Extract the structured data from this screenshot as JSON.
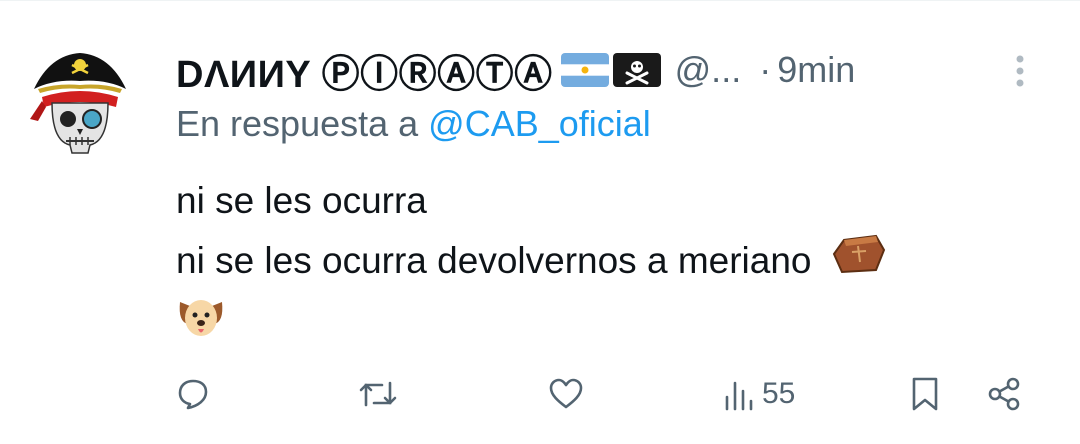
{
  "tweet": {
    "display_name": "DΛИИY ⓅⒾⓇⒶⓉⒶ",
    "handle": "@...",
    "separator": "·",
    "time": "9min",
    "reply_prefix": "En respuesta a",
    "reply_mention": "@CAB_oficial",
    "body_line_1": "ni se les ocurra",
    "body_line_2": "ni se les ocurra devolvernos a meriano",
    "views_count": "55"
  },
  "icons": {
    "avatar": "pirate-skull-avatar",
    "flags": [
      "argentina-flag-emoji",
      "pirate-flag-emoji"
    ],
    "body_emojis": [
      "coffin-emoji",
      "dog-face-emoji"
    ],
    "actions": [
      "reply-icon",
      "retweet-icon",
      "like-icon",
      "views-icon",
      "bookmark-icon",
      "share-icon"
    ]
  },
  "colors": {
    "text": "#0f1419",
    "secondary": "#536471",
    "link": "#1d9bf0"
  }
}
